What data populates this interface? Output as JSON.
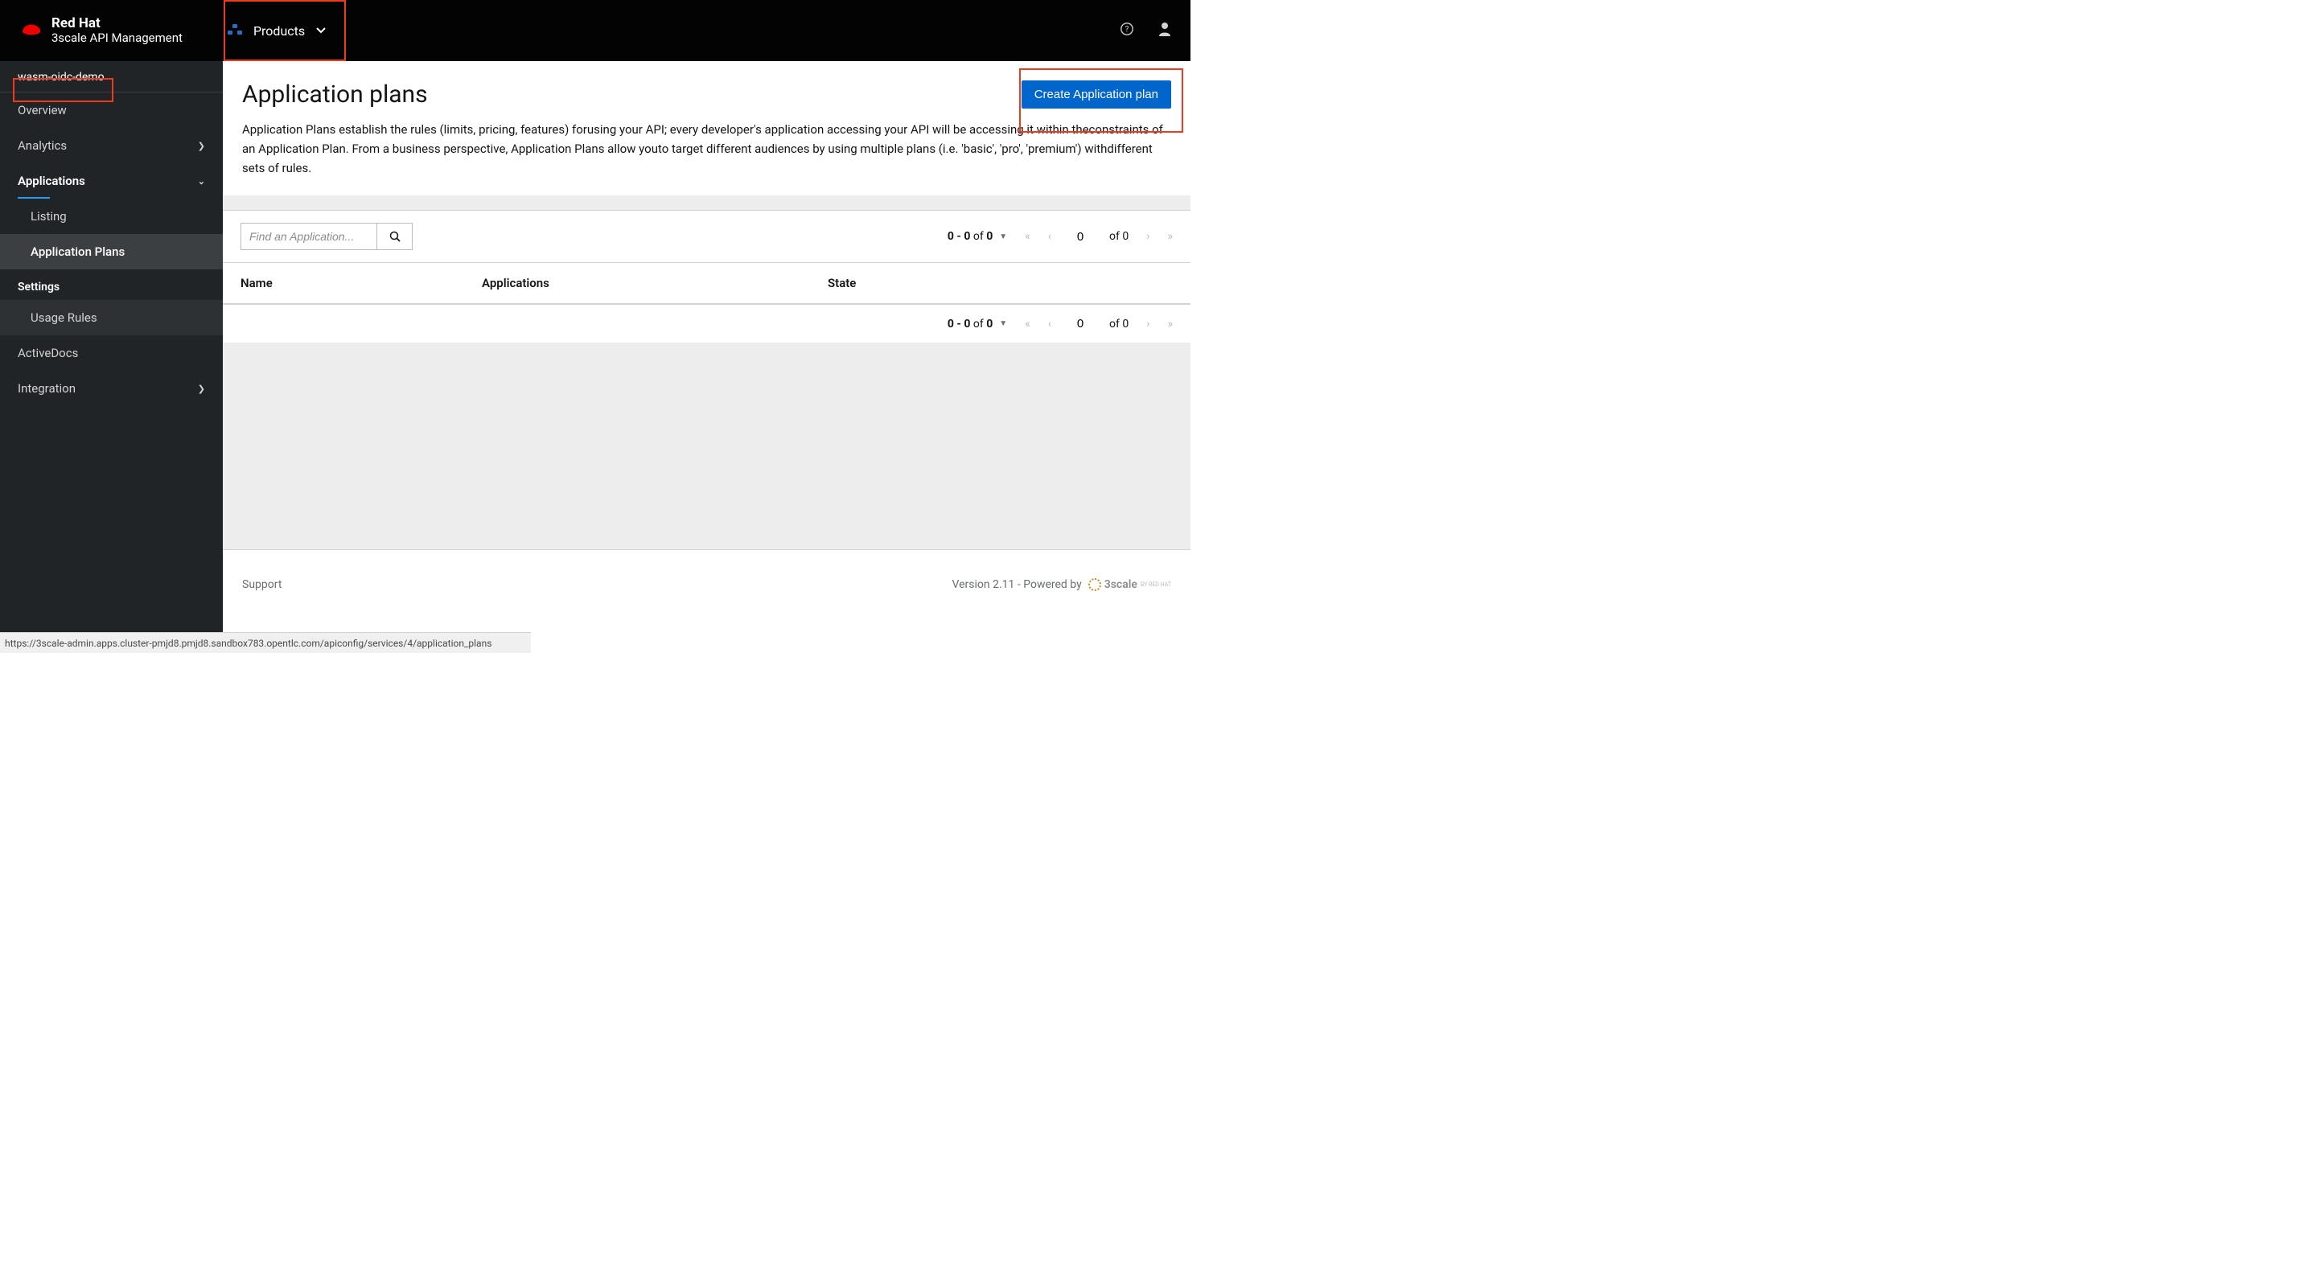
{
  "brand": {
    "line1": "Red Hat",
    "line2": "3scale API Management"
  },
  "topnav": {
    "products_label": "Products"
  },
  "sidebar": {
    "product_name": "wasm-oidc-demo",
    "items": {
      "overview": "Overview",
      "analytics": "Analytics",
      "applications": "Applications",
      "listing": "Listing",
      "app_plans": "Application Plans",
      "settings_group": "Settings",
      "usage_rules": "Usage Rules",
      "activedocs": "ActiveDocs",
      "integration": "Integration"
    }
  },
  "page": {
    "title": "Application plans",
    "create_btn": "Create Application plan",
    "description": "Application Plans establish the rules (limits, pricing, features) forusing your API; every developer's application accessing your API will be accessing it within theconstraints of an Application Plan. From a business perspective, Application Plans allow youto target different audiences by using multiple plans (i.e. 'basic', 'pro', 'premium') withdifferent sets of rules."
  },
  "toolbar": {
    "search_placeholder": "Find an Application...",
    "range_text": "0 - 0",
    "of_label": "of",
    "total": "0",
    "page_current": "0",
    "page_total": "0"
  },
  "table": {
    "columns": {
      "name": "Name",
      "apps": "Applications",
      "state": "State"
    },
    "rows": []
  },
  "footer": {
    "support": "Support",
    "version": "Version 2.11 - Powered by",
    "logo": "3scale",
    "byredhat": "BY RED HAT"
  },
  "statusbar": {
    "url": "https://3scale-admin.apps.cluster-pmjd8.pmjd8.sandbox783.opentlc.com/apiconfig/services/4/application_plans"
  }
}
